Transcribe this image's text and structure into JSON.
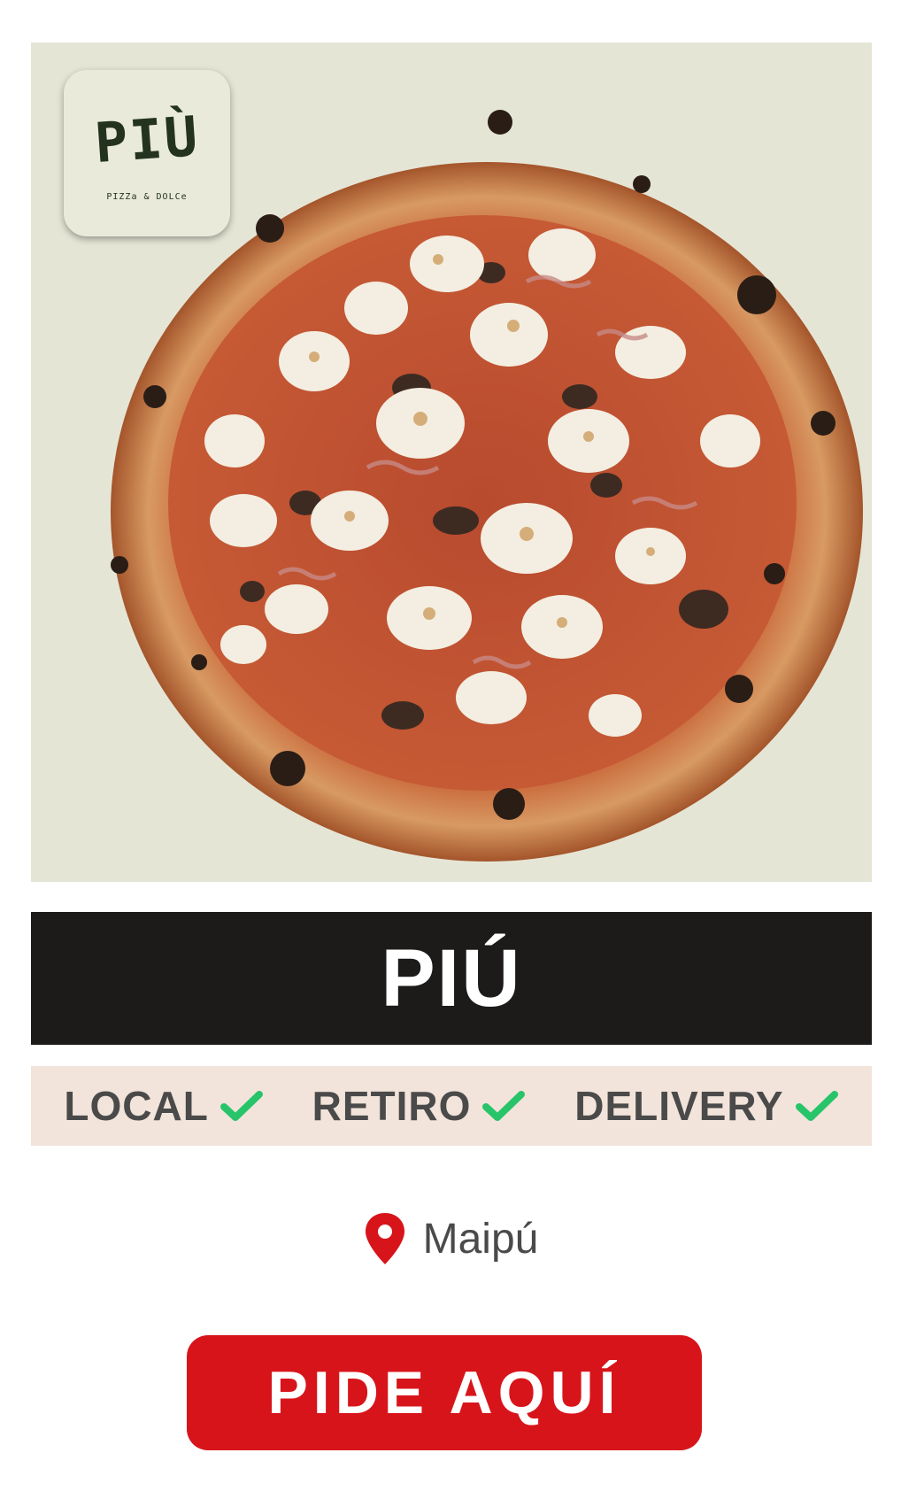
{
  "hero": {
    "image_icon": "pizza-photo",
    "logo": {
      "wordmark": "PIÙ",
      "tagline": "PIZZa & DOLCe"
    }
  },
  "restaurant": {
    "name": "PIÚ"
  },
  "services": [
    {
      "label": "LOCAL",
      "available": true,
      "icon": "check-icon"
    },
    {
      "label": "RETIRO",
      "available": true,
      "icon": "check-icon"
    },
    {
      "label": "DELIVERY",
      "available": true,
      "icon": "check-icon"
    }
  ],
  "location": {
    "icon": "map-pin-icon",
    "label": "Maipú"
  },
  "cta": {
    "label": "PIDE AQUÍ"
  },
  "colors": {
    "hero_background": "#e5e5d6",
    "name_bar": "#1c1b1a",
    "services_background": "#f2e4da",
    "check": "#27c46a",
    "pin": "#d8141b",
    "cta": "#d8141b",
    "logo_text": "#24331f"
  }
}
